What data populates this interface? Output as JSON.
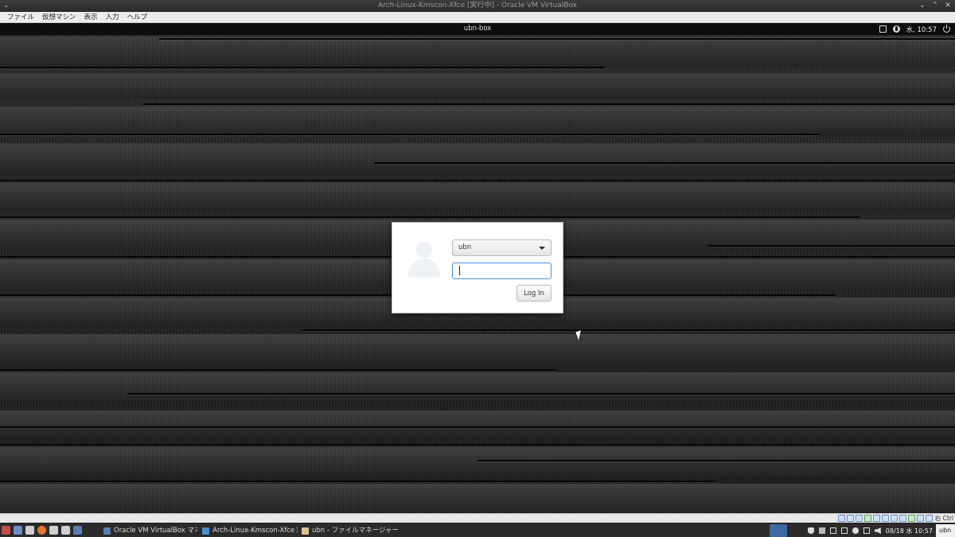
{
  "window": {
    "title": "Arch-Linux-Kmscon-Xfce [実行中] - Oracle VM VirtualBox"
  },
  "menubar": {
    "items": [
      "ファイル",
      "仮想マシン",
      "表示",
      "入力",
      "ヘルプ"
    ]
  },
  "guest_panel": {
    "hostname": "ubn-box",
    "clock": "水, 10:57"
  },
  "login": {
    "user": "ubn",
    "password_value": "",
    "login_label": "Log In"
  },
  "vbox_status": {
    "host_key": "右 Ctrl"
  },
  "taskbar": {
    "tasks": [
      {
        "label": "Oracle VM VirtualBox マネー..."
      },
      {
        "label": "Arch-Linux-Kmscon-Xfce [実..."
      },
      {
        "label": "ubn - ファイルマネージャー"
      }
    ],
    "clock": "08/18 水 10:57",
    "user": "ubn"
  },
  "colors": {
    "focus_ring": "#4a90d9",
    "dialog_bg": "#ffffff",
    "panel_bg": "#0d0d0d"
  }
}
